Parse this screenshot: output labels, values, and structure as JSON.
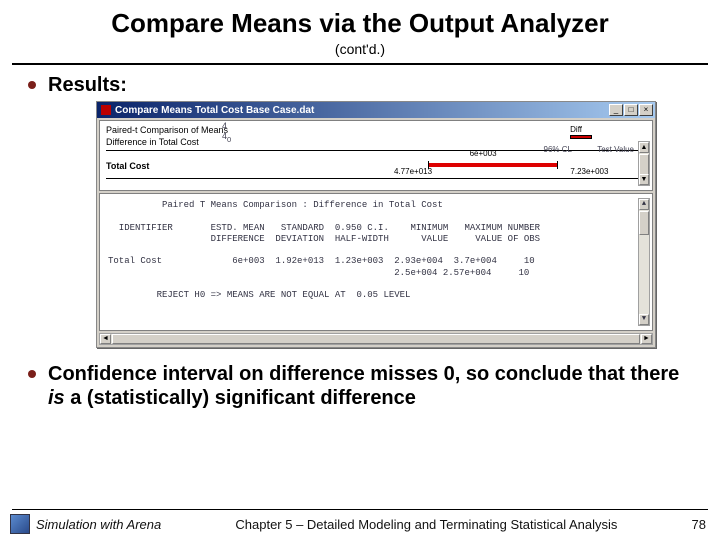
{
  "title": "Compare Means via the Output Analyzer",
  "subtitle": "(cont'd.)",
  "bullets": {
    "results": "Results:",
    "conclusion_pre": "Confidence interval on difference misses 0, so conclude that there ",
    "conclusion_emph": "is",
    "conclusion_post": " a (statistically) significant difference"
  },
  "dialog": {
    "title": "Compare Means   Total Cost Base Case.dat",
    "btn_min": "_",
    "btn_max": "□",
    "btn_close": "×",
    "top": {
      "heading": "Paired-t Comparison of Means",
      "subheading": "Difference in Total Cost",
      "diff_label": "Diff",
      "cl_left": "96% CL",
      "cl_right": "Test Value",
      "row_label": "Total Cost",
      "tick_a": "4",
      "tick_b": "4",
      "tick_c": "0",
      "center_val": "6e+003",
      "left_val": "4.77e+013",
      "right_val": "7.23e+003"
    },
    "bottom": {
      "title_line": "          Paired T Means Comparison : Difference in Total Cost",
      "hdr1": "  IDENTIFIER       ESTD. MEAN   STANDARD  0.950 C.I.    MINIMUM   MAXIMUM NUMBER",
      "hdr2": "                   DIFFERENCE  DEVIATION  HALF-WIDTH      VALUE     VALUE OF OBS",
      "row1": "Total Cost             6e+003  1.92e+013  1.23e+003  2.93e+004  3.7e+004     10",
      "row2": "                                                     2.5e+004 2.57e+004     10",
      "reject": "         REJECT H0 => MEANS ARE NOT EQUAL AT  0.05 LEVEL"
    },
    "scroll_up": "▲",
    "scroll_down": "▼",
    "scroll_left": "◄",
    "scroll_right": "►"
  },
  "footer": {
    "book": "Simulation with Arena",
    "chapter": "Chapter 5 – Detailed Modeling and Terminating Statistical Analysis",
    "page": "78"
  }
}
